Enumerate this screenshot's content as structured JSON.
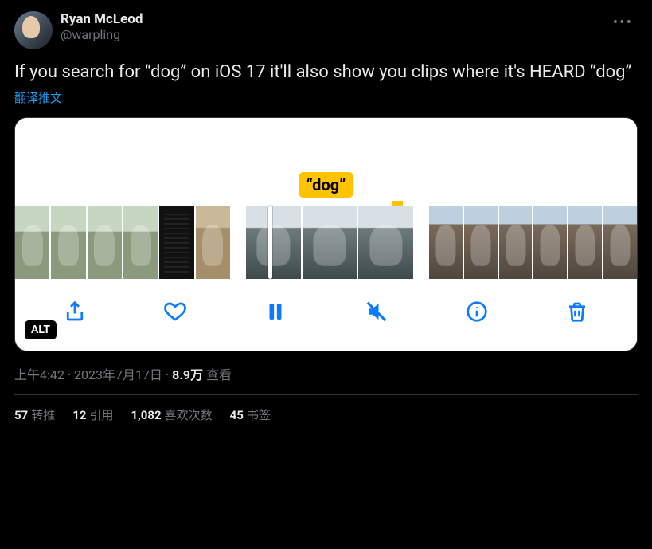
{
  "author": {
    "display_name": "Ryan McLeod",
    "handle": "@warpling"
  },
  "tweet": {
    "text": "If you search for “dog” on iOS 17 it'll also show you clips where it's HEARD “dog”",
    "translate_label": "翻译推文",
    "media_caption": "“dog”",
    "alt_badge": "ALT"
  },
  "meta": {
    "time": "上午4:42",
    "date": "2023年7月17日",
    "views_count": "8.9万",
    "views_label": "查看",
    "sep": " · "
  },
  "stats": {
    "retweets_count": "57",
    "retweets_label": "转推",
    "quotes_count": "12",
    "quotes_label": "引用",
    "likes_count": "1,082",
    "likes_label": "喜欢次数",
    "bookmarks_count": "45",
    "bookmarks_label": "书签"
  }
}
